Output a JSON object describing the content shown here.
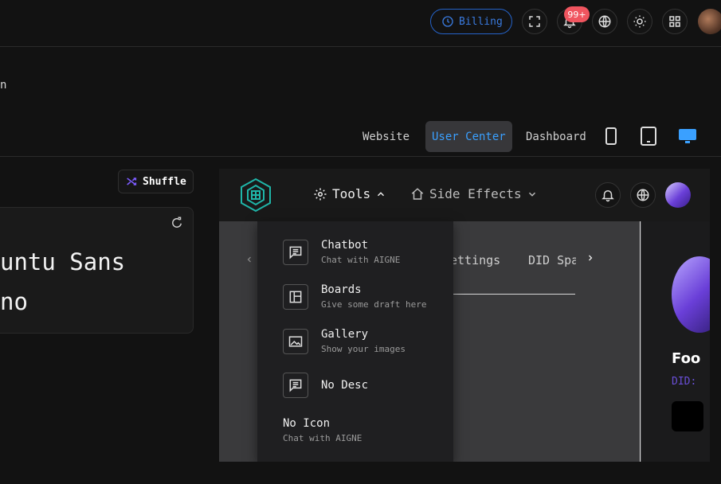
{
  "topbar": {
    "billing_label": "Billing",
    "notification_badge": "99+",
    "icons": [
      "clock-icon",
      "fullscreen-icon",
      "bell-icon",
      "globe-icon",
      "sun-icon",
      "apps-icon"
    ]
  },
  "breadcrumb": {
    "text": "n"
  },
  "device_tabs": {
    "website": "Website",
    "user_center": "User Center",
    "dashboard": "Dashboard",
    "active": "User Center"
  },
  "shuffle": {
    "label": "Shuffle"
  },
  "font_card": {
    "line1": "untu Sans",
    "line2": "no"
  },
  "preview": {
    "nav": {
      "tools": "Tools",
      "side_effects": "Side Effects"
    },
    "tabs": {
      "settings": "ettings",
      "did_spaces": "DID Spa"
    },
    "profile": {
      "name": "Foo",
      "did_prefix": "DID:"
    },
    "dropdown": [
      {
        "title": "Chatbot",
        "desc": "Chat with AIGNE",
        "icon": "chat-icon"
      },
      {
        "title": "Boards",
        "desc": "Give some draft here",
        "icon": "board-icon"
      },
      {
        "title": "Gallery",
        "desc": "Show your images",
        "icon": "image-icon"
      },
      {
        "title": "No Desc",
        "desc": "",
        "icon": "chat-icon"
      },
      {
        "title": "No Icon",
        "desc": "Chat with AIGNE",
        "icon": ""
      }
    ]
  },
  "colors": {
    "accent_blue": "#3aa0ff",
    "billing_blue": "#3a7be0",
    "badge_red": "#f0555f",
    "shuffle_purple": "#7c5cff"
  }
}
